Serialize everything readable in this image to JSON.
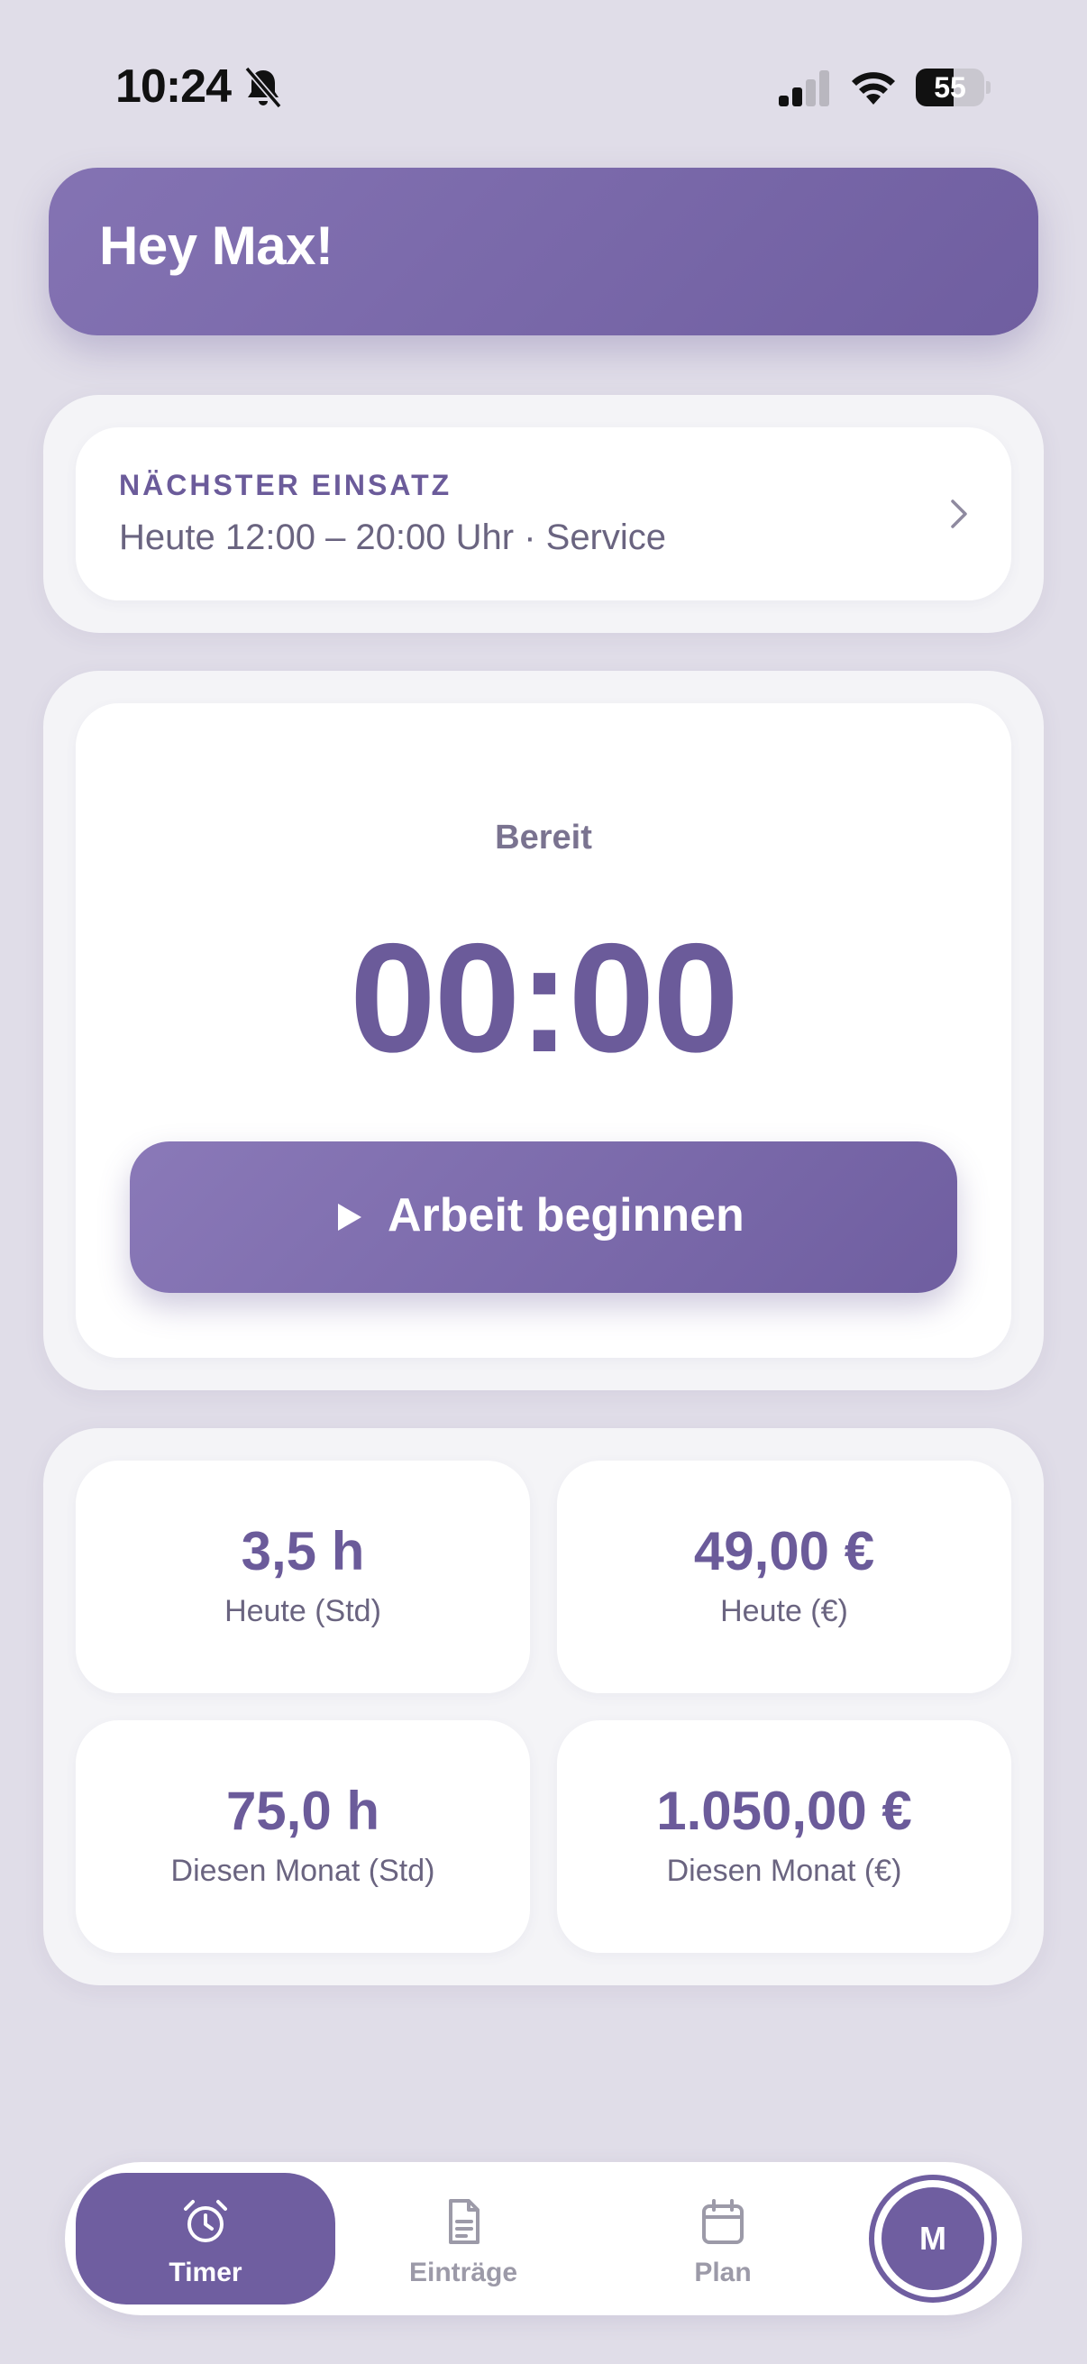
{
  "status_bar": {
    "time": "10:24",
    "battery_level": "55",
    "battery_fraction": 0.55,
    "icons": [
      "bell-slash-icon",
      "signal-icon",
      "wifi-icon",
      "battery-icon"
    ]
  },
  "greeting": "Hey Max!",
  "next_shift": {
    "label": "NÄCHSTER EINSATZ",
    "text": "Heute 12:00 – 20:00 Uhr · Service"
  },
  "timer": {
    "state": "Bereit",
    "clock": "00:00",
    "start_button": "Arbeit beginnen"
  },
  "stats": [
    {
      "value": "3,5 h",
      "caption": "Heute (Std)"
    },
    {
      "value": "49,00 €",
      "caption": "Heute (€)"
    },
    {
      "value": "75,0 h",
      "caption": "Diesen Monat (Std)"
    },
    {
      "value": "1.050,00 €",
      "caption": "Diesen Monat (€)"
    }
  ],
  "nav": {
    "tabs": [
      {
        "label": "Timer",
        "icon": "alarm-clock-icon",
        "active": true
      },
      {
        "label": "Einträge",
        "icon": "document-icon",
        "active": false
      },
      {
        "label": "Plan",
        "icon": "calendar-icon",
        "active": false
      }
    ],
    "avatar_initial": "M"
  },
  "colors": {
    "accent": "#6f5ea0",
    "background": "#e0dde8",
    "panel": "#f4f4f7",
    "card": "#ffffff",
    "muted_text": "#6a6480"
  }
}
